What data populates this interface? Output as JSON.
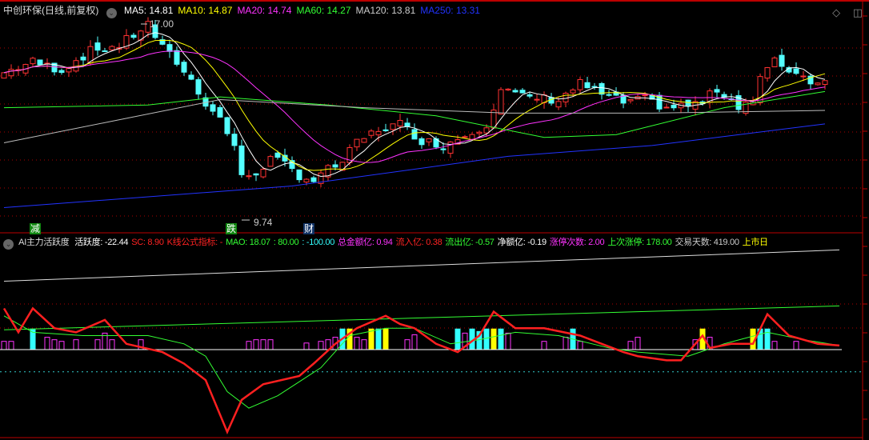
{
  "header": {
    "stock_title": "中创环保(日线,前复权)",
    "ma": [
      {
        "label": "MA5: 14.81",
        "color": "#ffffff"
      },
      {
        "label": "MA10: 14.87",
        "color": "#ffff00"
      },
      {
        "label": "MA20: 14.74",
        "color": "#ff33ff"
      },
      {
        "label": "MA60: 14.27",
        "color": "#33ff33"
      },
      {
        "label": "MA120: 13.81",
        "color": "#cccccc"
      },
      {
        "label": "MA250: 13.31",
        "color": "#2233ff"
      }
    ]
  },
  "price_chart": {
    "high_label": "17.00",
    "low_label": "9.74",
    "markers": [
      {
        "text": "减",
        "bg": "#118811"
      },
      {
        "text": "跌",
        "bg": "#118811"
      },
      {
        "text": "财",
        "bg": "#113366"
      }
    ],
    "price_path": [
      [
        0,
        15.2
      ],
      [
        4,
        15.6
      ],
      [
        8,
        15.3
      ],
      [
        12,
        16.0
      ],
      [
        16,
        16.2
      ],
      [
        20,
        17.0
      ],
      [
        22,
        16.1
      ],
      [
        24,
        15.6
      ],
      [
        26,
        14.9
      ],
      [
        28,
        14.1
      ],
      [
        30,
        13.5
      ],
      [
        32,
        12.5
      ],
      [
        33,
        11.3
      ],
      [
        35,
        11.5
      ],
      [
        37,
        12.0
      ],
      [
        39,
        11.8
      ],
      [
        41,
        11.4
      ],
      [
        43,
        11.2
      ],
      [
        45,
        11.6
      ],
      [
        47,
        11.9
      ],
      [
        49,
        12.6
      ],
      [
        52,
        13.1
      ],
      [
        55,
        13.3
      ],
      [
        58,
        12.7
      ],
      [
        61,
        12.5
      ],
      [
        64,
        12.9
      ],
      [
        67,
        13.3
      ],
      [
        69,
        14.6
      ],
      [
        72,
        14.3
      ],
      [
        77,
        14.2
      ],
      [
        80,
        14.8
      ],
      [
        83,
        14.4
      ],
      [
        86,
        14.1
      ],
      [
        89,
        14.2
      ],
      [
        92,
        13.9
      ],
      [
        95,
        14.0
      ],
      [
        97,
        14.1
      ],
      [
        99,
        14.6
      ],
      [
        102,
        14.0
      ],
      [
        104,
        14.2
      ],
      [
        105,
        15.0
      ],
      [
        107,
        15.6
      ],
      [
        110,
        15.2
      ],
      [
        112,
        14.9
      ],
      [
        114,
        14.9
      ]
    ],
    "ma60_path": [
      [
        0,
        13.9
      ],
      [
        20,
        14.0
      ],
      [
        30,
        14.3
      ],
      [
        45,
        14.0
      ],
      [
        60,
        13.6
      ],
      [
        75,
        12.8
      ],
      [
        85,
        12.9
      ],
      [
        100,
        13.9
      ],
      [
        114,
        14.5
      ]
    ],
    "ma120_path": [
      [
        0,
        12.6
      ],
      [
        15,
        13.4
      ],
      [
        30,
        14.2
      ],
      [
        50,
        13.9
      ],
      [
        70,
        13.7
      ],
      [
        90,
        13.7
      ],
      [
        114,
        13.8
      ]
    ],
    "ma250_path": [
      [
        0,
        10.2
      ],
      [
        40,
        11.0
      ],
      [
        70,
        12.1
      ],
      [
        90,
        12.5
      ],
      [
        114,
        13.3
      ]
    ]
  },
  "indicator": {
    "name": "AI主力活跃度",
    "items": [
      {
        "label": "活跃度: -22.44",
        "color": "#ffffff"
      },
      {
        "label": "SC: 8.90",
        "color": "#ff2222"
      },
      {
        "label": "K线公式指标: -",
        "color": "#ff2222"
      },
      {
        "label": "MAO: 18.07",
        "color": "#33ff33"
      },
      {
        "label": ": 80.00",
        "color": "#33ff33"
      },
      {
        "label": ": -100.00",
        "color": "#33ffff"
      },
      {
        "label": "总金额亿: 0.94",
        "color": "#ff33ff"
      },
      {
        "label": "流入亿: 0.38",
        "color": "#ff2222"
      },
      {
        "label": "流出亿: -0.57",
        "color": "#33ff33"
      },
      {
        "label": "净额亿: -0.19",
        "color": "#ffffff"
      },
      {
        "label": "涨停次数: 2.00",
        "color": "#ff33ff"
      },
      {
        "label": "上次涨停: 178.00",
        "color": "#33ff33"
      },
      {
        "label": "交易天数: 419.00",
        "color": "#cccccc"
      },
      {
        "label": "上市日",
        "color": "#ffff00"
      }
    ],
    "red_path": [
      [
        0,
        50
      ],
      [
        2,
        21
      ],
      [
        4,
        50
      ],
      [
        7,
        26
      ],
      [
        10,
        21
      ],
      [
        14,
        36
      ],
      [
        17,
        7
      ],
      [
        22,
        -3
      ],
      [
        25,
        -17
      ],
      [
        28,
        -37
      ],
      [
        31,
        -100
      ],
      [
        33,
        -61
      ],
      [
        36,
        -42
      ],
      [
        41,
        -32
      ],
      [
        43,
        -17
      ],
      [
        46,
        7
      ],
      [
        49,
        26
      ],
      [
        53,
        41
      ],
      [
        55,
        31
      ],
      [
        57,
        26
      ],
      [
        60,
        7
      ],
      [
        63,
        -3
      ],
      [
        66,
        17
      ],
      [
        68,
        46
      ],
      [
        71,
        26
      ],
      [
        75,
        26
      ],
      [
        80,
        17
      ],
      [
        83,
        7
      ],
      [
        86,
        -3
      ],
      [
        88,
        -8
      ],
      [
        92,
        -13
      ],
      [
        94,
        -13
      ],
      [
        96,
        7
      ],
      [
        97,
        17
      ],
      [
        98,
        2
      ],
      [
        101,
        7
      ],
      [
        104,
        7
      ],
      [
        106,
        43
      ],
      [
        109,
        17
      ],
      [
        113,
        7
      ],
      [
        116,
        5
      ]
    ],
    "green_path": [
      [
        0,
        41
      ],
      [
        4,
        21
      ],
      [
        11,
        17
      ],
      [
        20,
        17
      ],
      [
        25,
        7
      ],
      [
        28,
        -8
      ],
      [
        31,
        -51
      ],
      [
        34,
        -71
      ],
      [
        38,
        -56
      ],
      [
        44,
        -22
      ],
      [
        48,
        17
      ],
      [
        53,
        26
      ],
      [
        57,
        26
      ],
      [
        62,
        7
      ],
      [
        66,
        12
      ],
      [
        71,
        21
      ],
      [
        77,
        17
      ],
      [
        84,
        2
      ],
      [
        88,
        -3
      ],
      [
        95,
        -8
      ],
      [
        100,
        7
      ],
      [
        106,
        21
      ],
      [
        111,
        12
      ],
      [
        116,
        5
      ]
    ],
    "upper_line": [
      [
        0,
        24
      ],
      [
        116,
        53
      ]
    ],
    "top_line": [
      [
        0,
        83
      ],
      [
        116,
        121
      ]
    ],
    "cyan_level": -27,
    "bars": [
      [
        0,
        10,
        "m"
      ],
      [
        1,
        10,
        "m"
      ],
      [
        4,
        25,
        "c"
      ],
      [
        6,
        15,
        "m"
      ],
      [
        7,
        12,
        "m"
      ],
      [
        8,
        10,
        "m"
      ],
      [
        10,
        12,
        "m"
      ],
      [
        13,
        12,
        "m"
      ],
      [
        14,
        20,
        "m"
      ],
      [
        15,
        12,
        "m"
      ],
      [
        19,
        12,
        "m"
      ],
      [
        34,
        10,
        "m"
      ],
      [
        35,
        12,
        "m"
      ],
      [
        36,
        12,
        "m"
      ],
      [
        37,
        12,
        "m"
      ],
      [
        42,
        8,
        "m"
      ],
      [
        44,
        10,
        "m"
      ],
      [
        45,
        12,
        "m"
      ],
      [
        46,
        15,
        "m"
      ],
      [
        47,
        25,
        "c"
      ],
      [
        48,
        25,
        "y"
      ],
      [
        49,
        15,
        "m"
      ],
      [
        50,
        12,
        "m"
      ],
      [
        51,
        25,
        "y"
      ],
      [
        52,
        25,
        "c"
      ],
      [
        53,
        25,
        "y"
      ],
      [
        56,
        12,
        "m"
      ],
      [
        57,
        18,
        "m"
      ],
      [
        63,
        25,
        "c"
      ],
      [
        64,
        20,
        "m"
      ],
      [
        65,
        25,
        "c"
      ],
      [
        66,
        22,
        "c"
      ],
      [
        67,
        25,
        "c"
      ],
      [
        68,
        25,
        "y"
      ],
      [
        69,
        25,
        "c"
      ],
      [
        70,
        20,
        "m"
      ],
      [
        75,
        10,
        "m"
      ],
      [
        78,
        15,
        "m"
      ],
      [
        79,
        25,
        "c"
      ],
      [
        80,
        10,
        "m"
      ],
      [
        87,
        10,
        "m"
      ],
      [
        88,
        15,
        "m"
      ],
      [
        96,
        12,
        "m"
      ],
      [
        97,
        25,
        "y"
      ],
      [
        98,
        15,
        "m"
      ],
      [
        104,
        25,
        "y"
      ],
      [
        105,
        25,
        "c"
      ],
      [
        106,
        25,
        "c"
      ],
      [
        107,
        10,
        "m"
      ],
      [
        110,
        10,
        "m"
      ]
    ]
  }
}
